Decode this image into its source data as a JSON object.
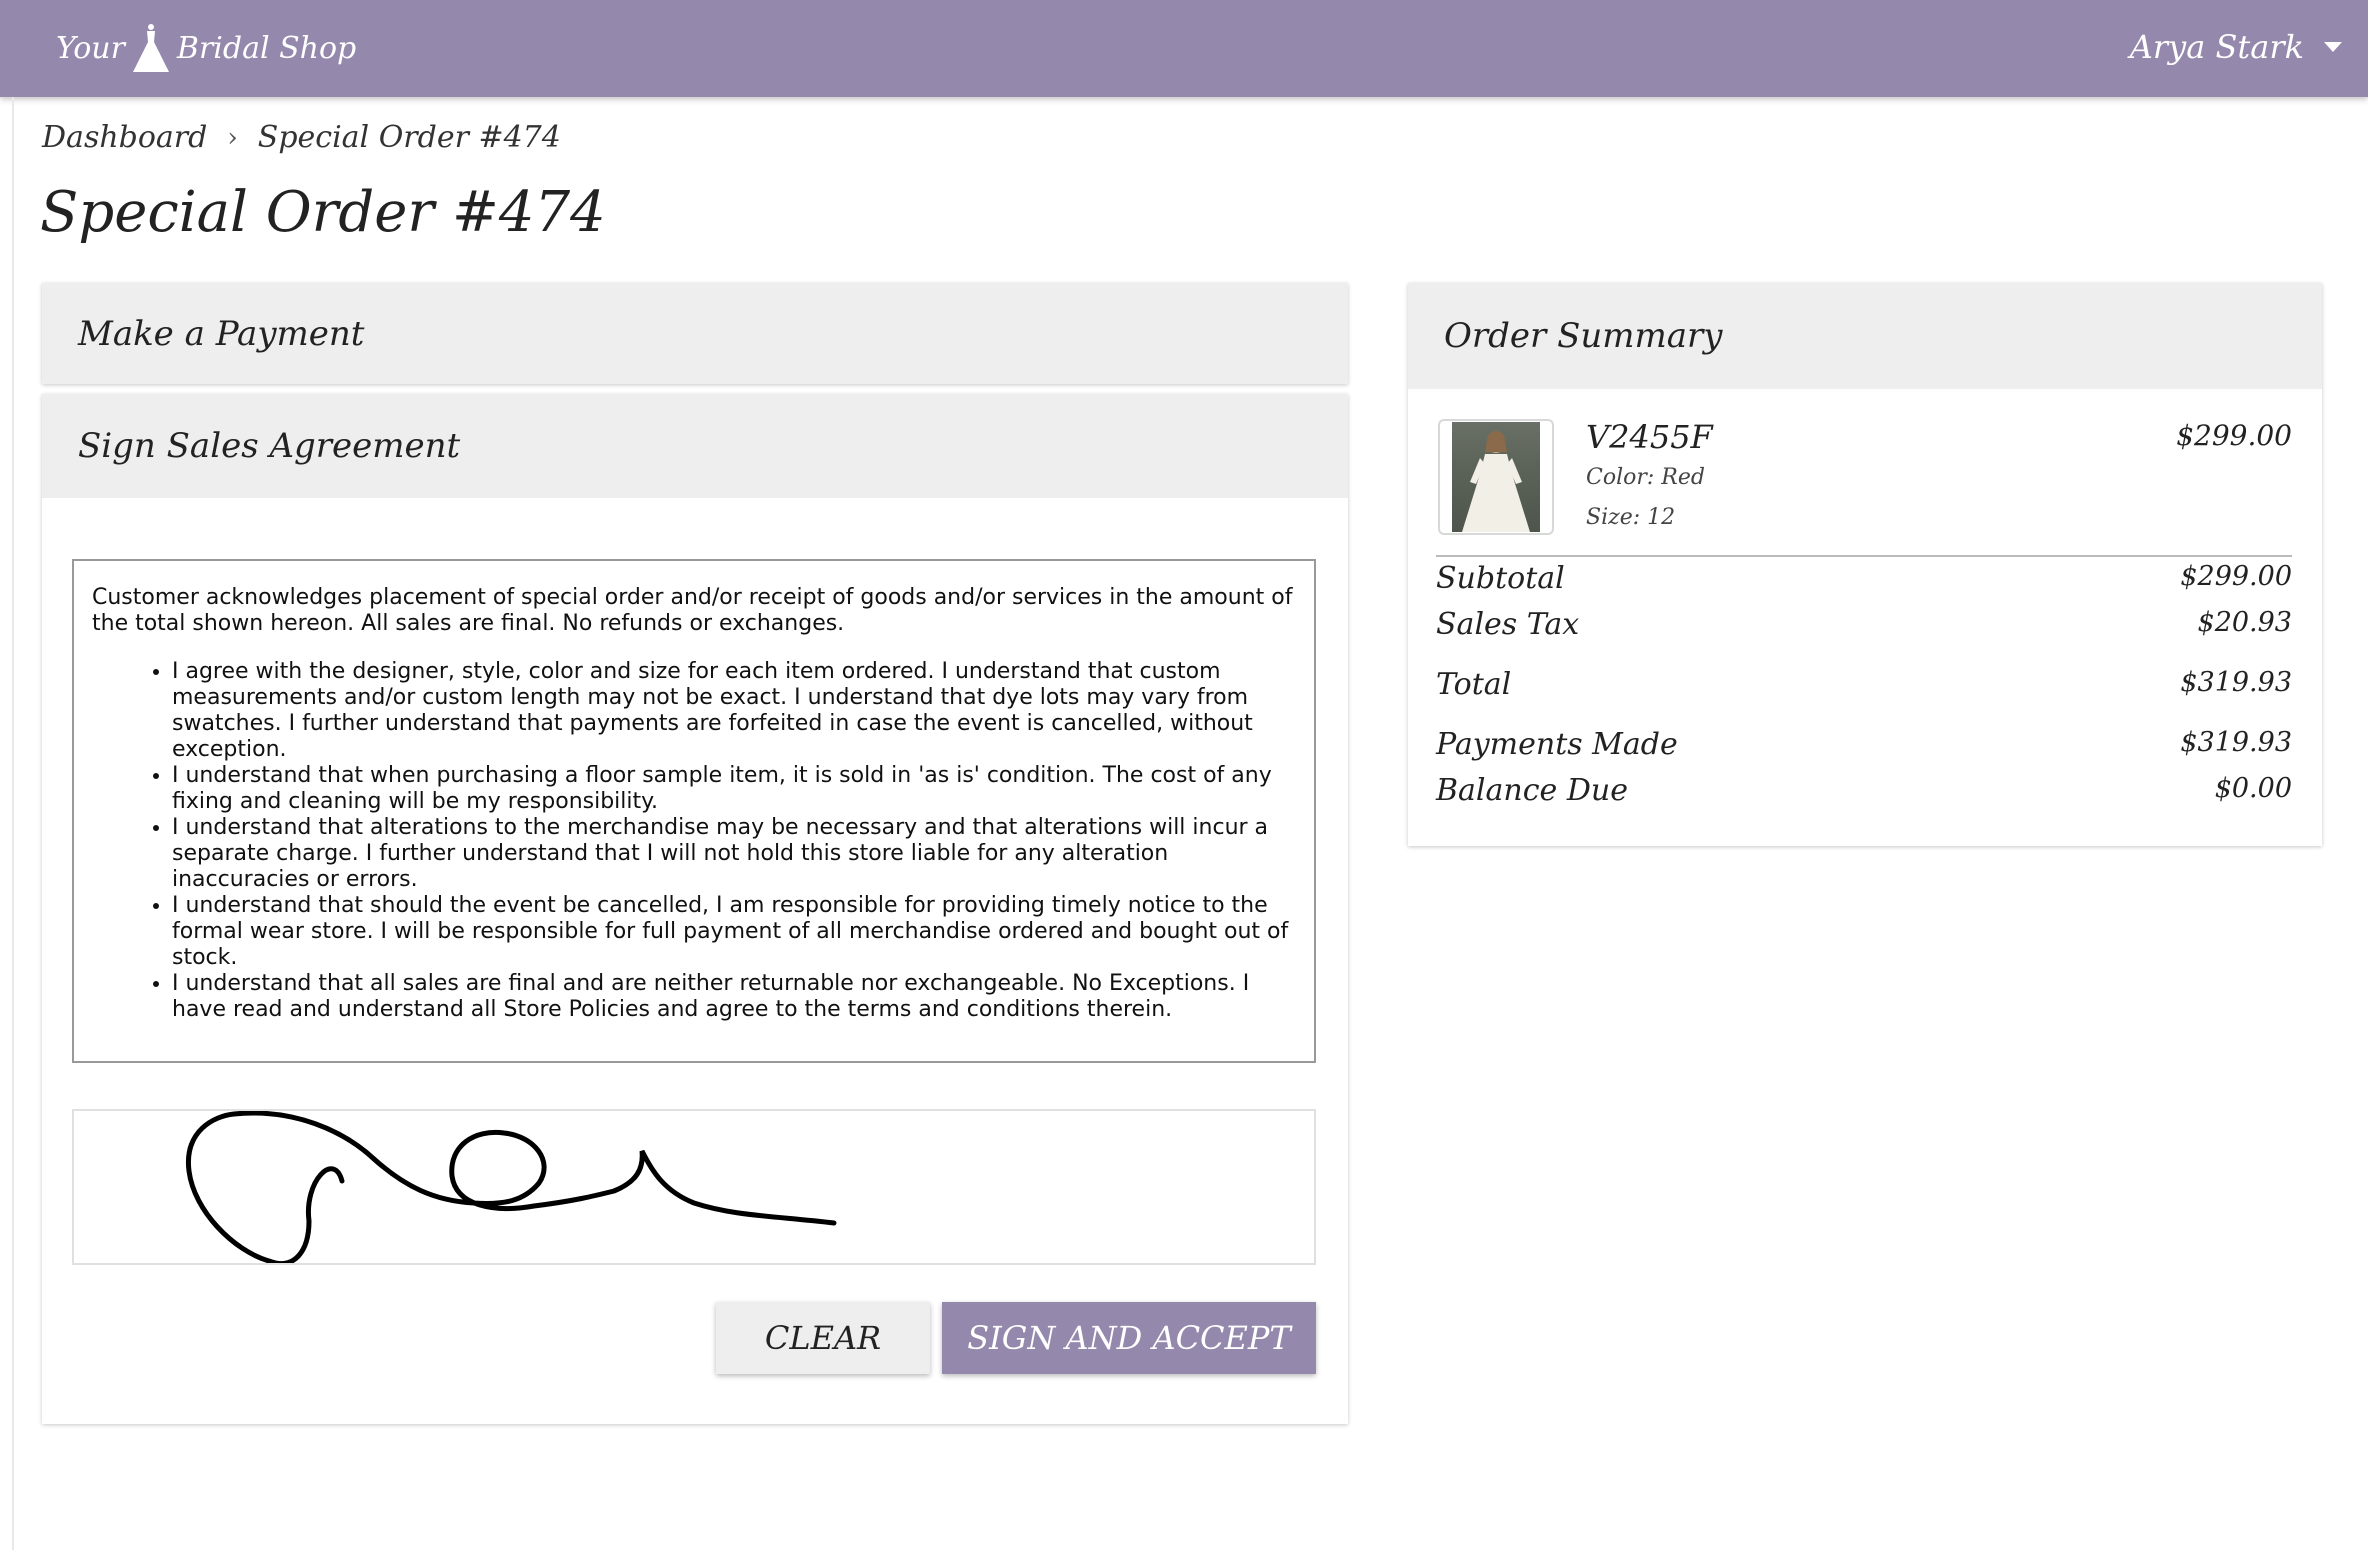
{
  "brand": {
    "name_left": "Your",
    "name_right": "Bridal Shop",
    "logo_icon": "wedding-dress-icon"
  },
  "user": {
    "name": "Arya Stark",
    "menu_icon": "caret-down-icon"
  },
  "breadcrumb": {
    "items": [
      "Dashboard",
      "Special Order #474"
    ],
    "separator": "›"
  },
  "page": {
    "title": "Special Order #474"
  },
  "payment_panel": {
    "title": "Make a Payment"
  },
  "agreement_panel": {
    "title": "Sign Sales Agreement",
    "intro": "Customer acknowledges placement of special order and/or receipt of goods and/or services in the amount of the total shown hereon. All sales are final. No refunds or exchanges.",
    "terms": [
      "I agree with the designer, style, color and size for each item ordered. I understand that custom measurements and/or custom length may not be exact. I understand that dye lots may vary from swatches.  I further understand that payments are forfeited in case the event is cancelled, without exception.",
      "I understand that when purchasing a floor sample item, it is sold in 'as is' condition. The cost of any fixing and cleaning will be my responsibility.",
      "I understand that alterations to the merchandise may be necessary and that alterations will incur a separate charge.  I further understand that I will not hold this store liable for any alteration inaccuracies or errors.",
      "I understand that should the event be cancelled, I am responsible for providing timely notice to the formal wear store. I will be responsible for full payment of all merchandise ordered and bought out of stock.",
      "I understand that all sales are final and are neither returnable nor exchangeable.  No Exceptions. I have read and understand all Store Policies and agree to the terms and conditions therein."
    ],
    "clear_label": "CLEAR",
    "sign_label": "SIGN AND ACCEPT"
  },
  "summary": {
    "title": "Order Summary",
    "item": {
      "name": "V2455F",
      "color": "Color: Red",
      "size": "Size: 12",
      "price": "$299.00"
    },
    "rows": {
      "subtotal_label": "Subtotal",
      "subtotal_value": "$299.00",
      "tax_label": "Sales Tax",
      "tax_value": "$20.93",
      "total_label": "Total",
      "total_value": "$319.93",
      "payments_label": "Payments Made",
      "payments_value": "$319.93",
      "balance_label": "Balance Due",
      "balance_value": "$0.00"
    }
  },
  "colors": {
    "brand": "#9488ad",
    "panel_header": "#eeeeee"
  }
}
